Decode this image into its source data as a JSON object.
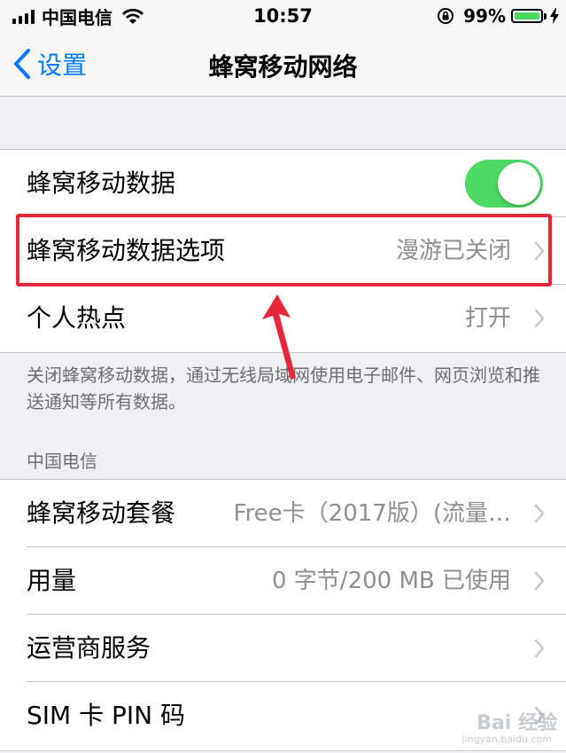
{
  "status_bar": {
    "carrier": "中国电信",
    "time": "10:57",
    "battery_percent": "99%",
    "battery_level": 0.99,
    "battery_color": "#4cd964"
  },
  "nav": {
    "back_label": "设置",
    "title": "蜂窝移动网络",
    "accent_color": "#007aff"
  },
  "cellular_group": {
    "rows": [
      {
        "label": "蜂窝移动数据",
        "toggle_on": true
      },
      {
        "label": "蜂窝移动数据选项",
        "value": "漫游已关闭"
      },
      {
        "label": "个人热点",
        "value": "打开"
      }
    ],
    "footer": "关闭蜂窝移动数据，通过无线局域网使用电子邮件、网页浏览和推送通知等所有数据。"
  },
  "carrier_section": {
    "header": "中国电信",
    "rows": [
      {
        "label": "蜂窝移动套餐",
        "value": "Free卡（2017版）(流量…"
      },
      {
        "label": "用量",
        "value": "0 字节/200 MB 已使用"
      },
      {
        "label": "运营商服务",
        "value": ""
      },
      {
        "label": "SIM 卡 PIN 码",
        "value": ""
      }
    ]
  },
  "annotation": {
    "highlight_color": "#e8283a"
  },
  "watermark": {
    "text": "Bai 经验",
    "sub": "jingyan.baidu.com"
  }
}
